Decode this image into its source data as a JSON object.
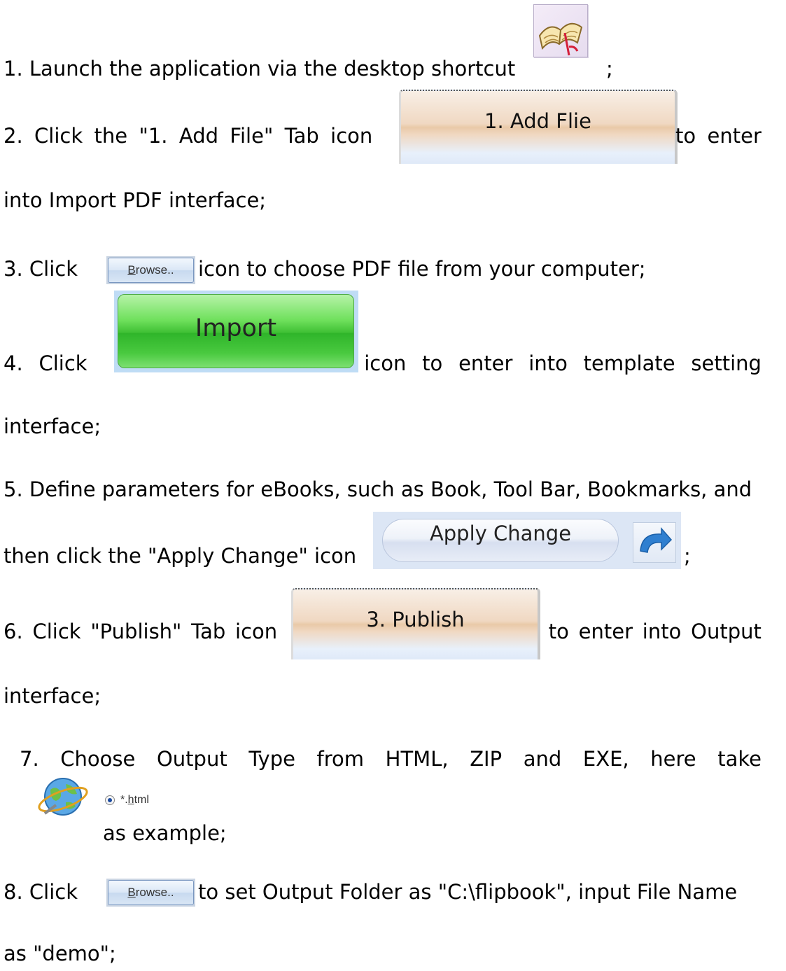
{
  "steps": {
    "s1": {
      "text": "1. Launch the application via the desktop shortcut",
      "after": ";"
    },
    "s2": {
      "w1": "2.",
      "w2": "Click",
      "w3": "the",
      "w4": "\"1.",
      "w5": "Add",
      "w6": "File\"",
      "w7": "Tab",
      "w8": "icon",
      "w9": "to",
      "w10": "enter",
      "line2": "into Import PDF interface;"
    },
    "s3": {
      "before": "3. Click",
      "after": "icon to choose PDF file from your computer;"
    },
    "s4": {
      "w1": "4.",
      "w2": "Click",
      "w3": "icon",
      "w4": "to",
      "w5": "enter",
      "w6": "into",
      "w7": "template",
      "w8": "setting",
      "line2": "interface;"
    },
    "s5": {
      "line1": "5. Define parameters for eBooks, such as Book, Tool Bar, Bookmarks, and",
      "line2": "then click the \"Apply Change\" icon",
      "after": ";"
    },
    "s6": {
      "w1": "6.",
      "w2": "Click",
      "w3": "\"Publish\"",
      "w4": "Tab",
      "w5": "icon",
      "w6": "to",
      "w7": "enter",
      "w8": "into",
      "w9": "Output",
      "line2": "interface;"
    },
    "s7": {
      "w1": "7.",
      "w2": "Choose",
      "w3": "Output",
      "w4": "Type",
      "w5": "from",
      "w6": "HTML,",
      "w7": "ZIP",
      "w8": "and",
      "w9": "EXE,",
      "w10": "here",
      "w11": "take",
      "line2": "as example;"
    },
    "s8": {
      "before": "8. Click",
      "after": "to set Output Folder as \"C:\\flipbook\", input File Name",
      "line2": "as \"demo\";"
    }
  },
  "images": {
    "add_file_tab": "1. Add Flie",
    "browse_button": "Browse..",
    "import_button": "Import",
    "apply_change_button": "Apply Change",
    "publish_tab": "3. Publish",
    "html_option": "*.html"
  },
  "icons": {
    "shortcut": "open-book-icon",
    "apply": "curved-arrow-icon",
    "output_type": "globe-icon"
  },
  "colors": {
    "import_green": "#3fc034",
    "tab_peach": "#f0d8c2",
    "apply_blue": "#2f7fd0"
  }
}
